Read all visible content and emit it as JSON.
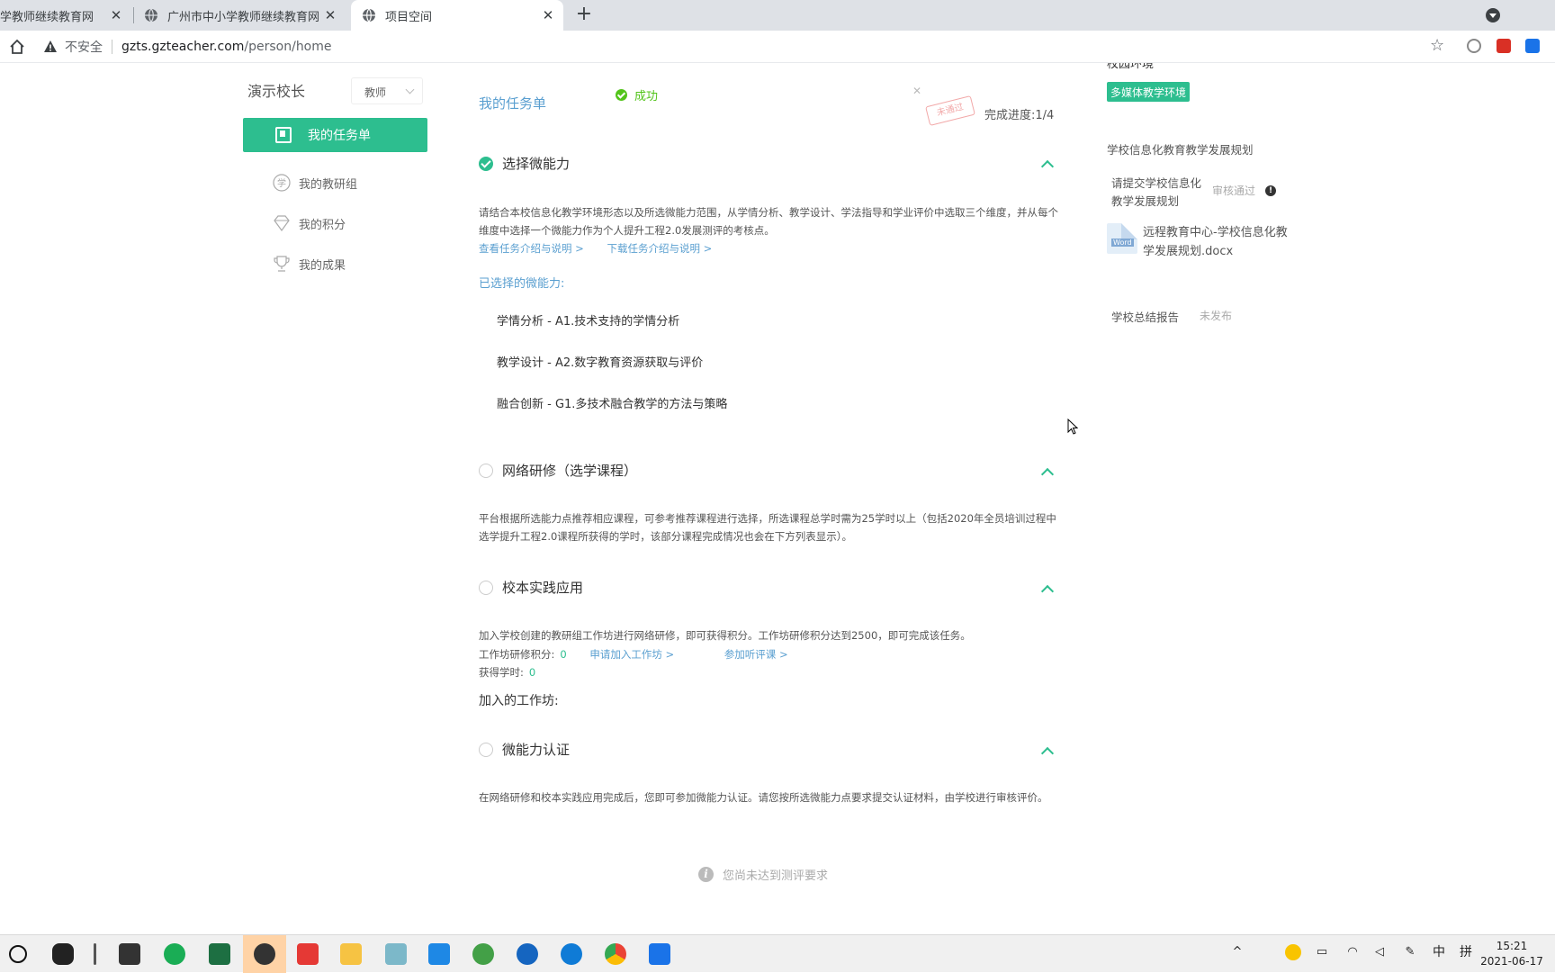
{
  "browser": {
    "tabs": [
      {
        "title": "学教师继续教育网"
      },
      {
        "title": "广州市中小学教师继续教育网"
      },
      {
        "title": "项目空间"
      }
    ],
    "security_label": "不安全",
    "url_host": "gzts.gzteacher.com",
    "url_path": "/person/home"
  },
  "sidebar": {
    "username": "演示校长",
    "role": "教师",
    "active_item": "我的任务单",
    "items": [
      {
        "label": "我的教研组",
        "icon": "study-group-icon"
      },
      {
        "label": "我的积分",
        "icon": "points-icon"
      },
      {
        "label": "我的成果",
        "icon": "trophy-icon"
      }
    ]
  },
  "main": {
    "title": "我的任务单",
    "toast": "成功",
    "stamp": "未通过",
    "progress": "完成进度:1/4",
    "sections": [
      {
        "heading": "选择微能力",
        "completed": true,
        "desc": "请结合本校信息化教学环境形态以及所选微能力范围，从学情分析、教学设计、学法指导和学业评价中选取三个维度，并从每个维度中选择一个微能力作为个人提升工程2.0发展测评的考核点。",
        "links": [
          "查看任务介绍与说明 >",
          "下载任务介绍与说明 >"
        ],
        "selected_label": "已选择的微能力:",
        "selected": [
          "学情分析 - A1.技术支持的学情分析",
          "教学设计 - A2.数字教育资源获取与评价",
          "融合创新 - G1.多技术融合教学的方法与策略"
        ]
      },
      {
        "heading": "网络研修（选学课程）",
        "completed": false,
        "desc": "平台根据所选能力点推荐相应课程，可参考推荐课程进行选择，所选课程总学时需为25学时以上（包括2020年全员培训过程中选学提升工程2.0课程所获得的学时，该部分课程完成情况也会在下方列表显示）。"
      },
      {
        "heading": "校本实践应用",
        "completed": false,
        "desc": "加入学校创建的教研组工作坊进行网络研修，即可获得积分。工作坊研修积分达到2500，即可完成该任务。",
        "points_label": "工作坊研修积分:",
        "points_value": "0",
        "apply_link": "申请加入工作坊 >",
        "lesson_link": "参加听评课 >",
        "hours_label": "获得学时:",
        "hours_value": "0",
        "workshops_label": "加入的工作坊:"
      },
      {
        "heading": "微能力认证",
        "completed": false,
        "desc": "在网络研修和校本实践应用完成后，您即可参加微能力认证。请您按所选微能力点要求提交认证材料，由学校进行审核评价。"
      }
    ],
    "notice": "您尚未达到测评要求"
  },
  "right": {
    "cut_text": "校园环境",
    "environment_tag": "多媒体教学环境",
    "plan_title": "学校信息化教育教学发展规划",
    "plan_request": "请提交学校信息化教学发展规划",
    "plan_status": "审核通过",
    "file_badge": "Word",
    "file_name": "远程教育中心-学校信息化教学发展规划.docx",
    "summary_title": "学校总结报告",
    "summary_status": "未发布"
  },
  "taskbar": {
    "ime_1": "中",
    "ime_2": "拼",
    "time": "15:21",
    "date": "2021-06-17"
  },
  "colors": {
    "accent": "#2dbe8f",
    "link": "#5a9fd0",
    "success": "#52c41a"
  }
}
